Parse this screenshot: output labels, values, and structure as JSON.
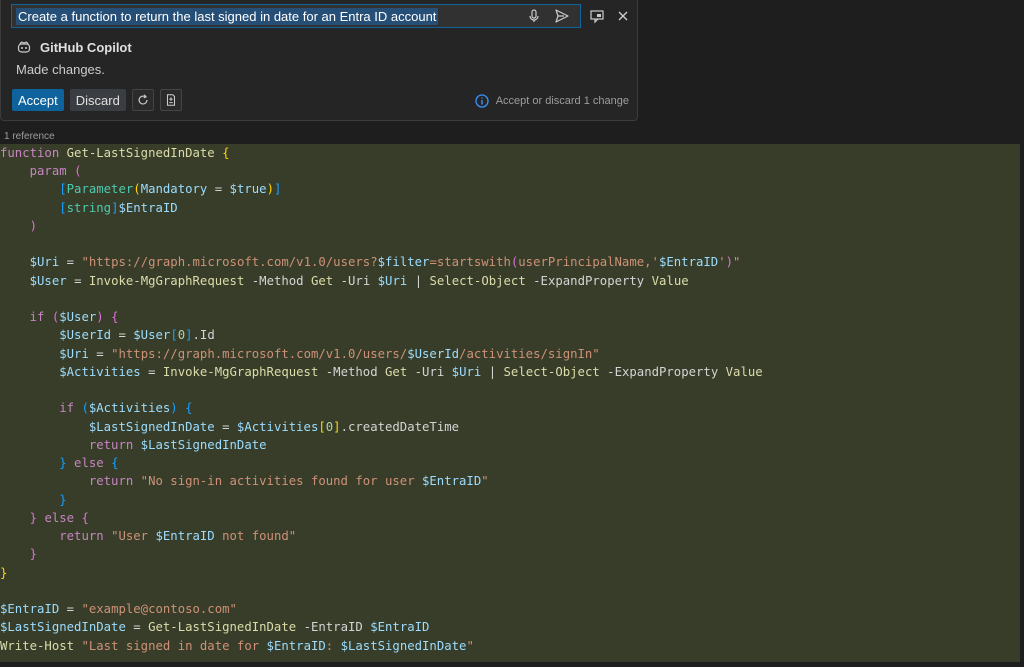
{
  "chat": {
    "prompt": "Create a function to return the last signed in date for an Entra ID account",
    "assistant_name": "GitHub Copilot",
    "status": "Made changes.",
    "accept_label": "Accept",
    "discard_label": "Discard",
    "change_note": "Accept or discard 1 change"
  },
  "editor": {
    "reference": "1 reference"
  },
  "colors": {
    "accent": "#0e639c",
    "diff_background": "#373d29"
  }
}
